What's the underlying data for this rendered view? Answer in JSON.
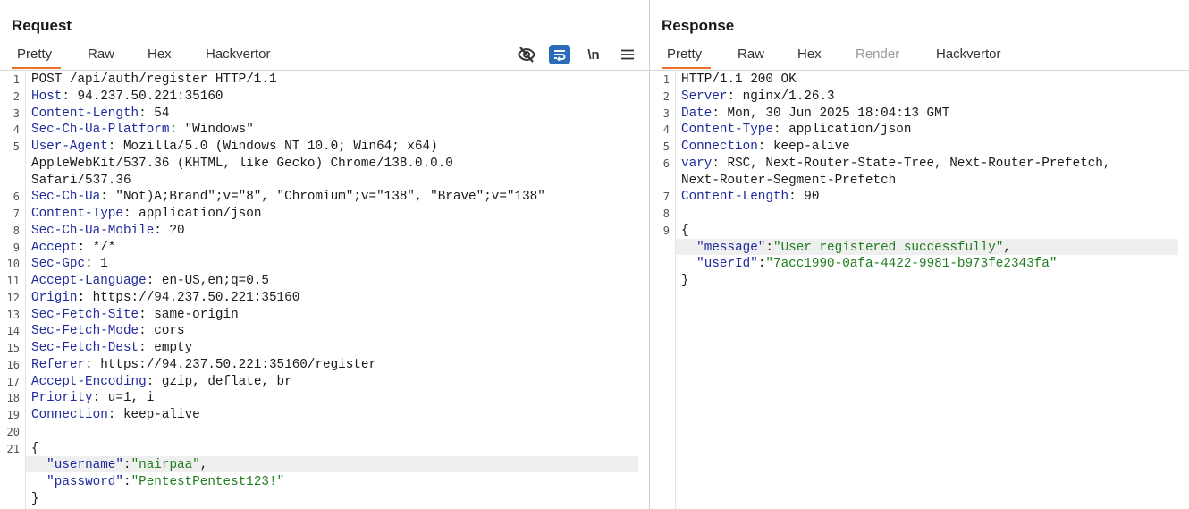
{
  "request": {
    "title": "Request",
    "tabs": [
      {
        "label": "Pretty",
        "active": true
      },
      {
        "label": "Raw",
        "active": false
      },
      {
        "label": "Hex",
        "active": false
      },
      {
        "label": "Hackvertor",
        "active": false
      }
    ],
    "tools": {
      "hide_icon": "eye-slash-icon",
      "wrap_icon": "word-wrap-icon",
      "newline_label": "\\n",
      "menu_icon": "hamburger-menu-icon"
    },
    "lines": [
      {
        "num": "1",
        "parts": [
          {
            "t": "POST /api/auth/register HTTP/1.1"
          }
        ]
      },
      {
        "num": "2",
        "parts": [
          {
            "t": "Host",
            "k": 1
          },
          {
            "t": ": 94.237.50.221:35160"
          }
        ]
      },
      {
        "num": "3",
        "parts": [
          {
            "t": "Content-Length",
            "k": 1
          },
          {
            "t": ": 54"
          }
        ]
      },
      {
        "num": "4",
        "parts": [
          {
            "t": "Sec-Ch-Ua-Platform",
            "k": 1
          },
          {
            "t": ": \"Windows\""
          }
        ]
      },
      {
        "num": "5",
        "parts": [
          {
            "t": "User-Agent",
            "k": 1
          },
          {
            "t": ": Mozilla/5.0 (Windows NT 10.0; Win64; x64)"
          }
        ]
      },
      {
        "num": "",
        "parts": [
          {
            "t": "AppleWebKit/537.36 (KHTML, like Gecko) Chrome/138.0.0.0"
          }
        ]
      },
      {
        "num": "",
        "parts": [
          {
            "t": "Safari/537.36"
          }
        ]
      },
      {
        "num": "6",
        "parts": [
          {
            "t": "Sec-Ch-Ua",
            "k": 1
          },
          {
            "t": ": \"Not)A;Brand\";v=\"8\", \"Chromium\";v=\"138\", \"Brave\";v=\"138\""
          }
        ]
      },
      {
        "num": "7",
        "parts": [
          {
            "t": "Content-Type",
            "k": 1
          },
          {
            "t": ": application/json"
          }
        ]
      },
      {
        "num": "8",
        "parts": [
          {
            "t": "Sec-Ch-Ua-Mobile",
            "k": 1
          },
          {
            "t": ": ?0"
          }
        ]
      },
      {
        "num": "9",
        "parts": [
          {
            "t": "Accept",
            "k": 1
          },
          {
            "t": ": */*"
          }
        ]
      },
      {
        "num": "10",
        "parts": [
          {
            "t": "Sec-Gpc",
            "k": 1
          },
          {
            "t": ": 1"
          }
        ]
      },
      {
        "num": "11",
        "parts": [
          {
            "t": "Accept-Language",
            "k": 1
          },
          {
            "t": ": en-US,en;q=0.5"
          }
        ]
      },
      {
        "num": "12",
        "parts": [
          {
            "t": "Origin",
            "k": 1
          },
          {
            "t": ": https://94.237.50.221:35160"
          }
        ]
      },
      {
        "num": "13",
        "parts": [
          {
            "t": "Sec-Fetch-Site",
            "k": 1
          },
          {
            "t": ": same-origin"
          }
        ]
      },
      {
        "num": "14",
        "parts": [
          {
            "t": "Sec-Fetch-Mode",
            "k": 1
          },
          {
            "t": ": cors"
          }
        ]
      },
      {
        "num": "15",
        "parts": [
          {
            "t": "Sec-Fetch-Dest",
            "k": 1
          },
          {
            "t": ": empty"
          }
        ]
      },
      {
        "num": "16",
        "parts": [
          {
            "t": "Referer",
            "k": 1
          },
          {
            "t": ": https://94.237.50.221:35160/register"
          }
        ]
      },
      {
        "num": "17",
        "parts": [
          {
            "t": "Accept-Encoding",
            "k": 1
          },
          {
            "t": ": gzip, deflate, br"
          }
        ]
      },
      {
        "num": "18",
        "parts": [
          {
            "t": "Priority",
            "k": 1
          },
          {
            "t": ": u=1, i"
          }
        ]
      },
      {
        "num": "19",
        "parts": [
          {
            "t": "Connection",
            "k": 1
          },
          {
            "t": ": keep-alive"
          }
        ]
      },
      {
        "num": "20",
        "parts": [
          {
            "t": ""
          }
        ]
      },
      {
        "num": "21",
        "parts": [
          {
            "t": "{"
          }
        ]
      },
      {
        "num": "",
        "hl": true,
        "parts": [
          {
            "t": "  "
          },
          {
            "t": "\"username\"",
            "k": 1
          },
          {
            "t": ":"
          },
          {
            "t": "\"nairpaa\"",
            "s": 1
          },
          {
            "t": ","
          }
        ]
      },
      {
        "num": "",
        "parts": [
          {
            "t": "  "
          },
          {
            "t": "\"password\"",
            "k": 1
          },
          {
            "t": ":"
          },
          {
            "t": "\"PentestPentest123!\"",
            "s": 1
          }
        ]
      },
      {
        "num": "",
        "parts": [
          {
            "t": "}"
          }
        ]
      }
    ]
  },
  "response": {
    "title": "Response",
    "tabs": [
      {
        "label": "Pretty",
        "active": true
      },
      {
        "label": "Raw",
        "active": false
      },
      {
        "label": "Hex",
        "active": false
      },
      {
        "label": "Render",
        "active": false,
        "disabled": true
      },
      {
        "label": "Hackvertor",
        "active": false
      }
    ],
    "lines": [
      {
        "num": "1",
        "parts": [
          {
            "t": "HTTP/1.1 200 OK"
          }
        ]
      },
      {
        "num": "2",
        "parts": [
          {
            "t": "Server",
            "k": 1
          },
          {
            "t": ": nginx/1.26.3"
          }
        ]
      },
      {
        "num": "3",
        "parts": [
          {
            "t": "Date",
            "k": 1
          },
          {
            "t": ": Mon, 30 Jun 2025 18:04:13 GMT"
          }
        ]
      },
      {
        "num": "4",
        "parts": [
          {
            "t": "Content-Type",
            "k": 1
          },
          {
            "t": ": application/json"
          }
        ]
      },
      {
        "num": "5",
        "parts": [
          {
            "t": "Connection",
            "k": 1
          },
          {
            "t": ": keep-alive"
          }
        ]
      },
      {
        "num": "6",
        "parts": [
          {
            "t": "vary",
            "k": 1
          },
          {
            "t": ": RSC, Next-Router-State-Tree, Next-Router-Prefetch,"
          }
        ]
      },
      {
        "num": "",
        "parts": [
          {
            "t": "Next-Router-Segment-Prefetch"
          }
        ]
      },
      {
        "num": "7",
        "parts": [
          {
            "t": "Content-Length",
            "k": 1
          },
          {
            "t": ": 90"
          }
        ]
      },
      {
        "num": "8",
        "parts": [
          {
            "t": ""
          }
        ]
      },
      {
        "num": "9",
        "parts": [
          {
            "t": "{"
          }
        ]
      },
      {
        "num": "",
        "hl": true,
        "parts": [
          {
            "t": "  "
          },
          {
            "t": "\"message\"",
            "k": 1
          },
          {
            "t": ":"
          },
          {
            "t": "\"User registered successfully\"",
            "s": 1
          },
          {
            "t": ","
          }
        ]
      },
      {
        "num": "",
        "parts": [
          {
            "t": "  "
          },
          {
            "t": "\"userId\"",
            "k": 1
          },
          {
            "t": ":"
          },
          {
            "t": "\"7acc1990-0afa-4422-9981-b973fe2343fa\"",
            "s": 1
          }
        ]
      },
      {
        "num": "",
        "parts": [
          {
            "t": "}"
          }
        ]
      }
    ]
  }
}
